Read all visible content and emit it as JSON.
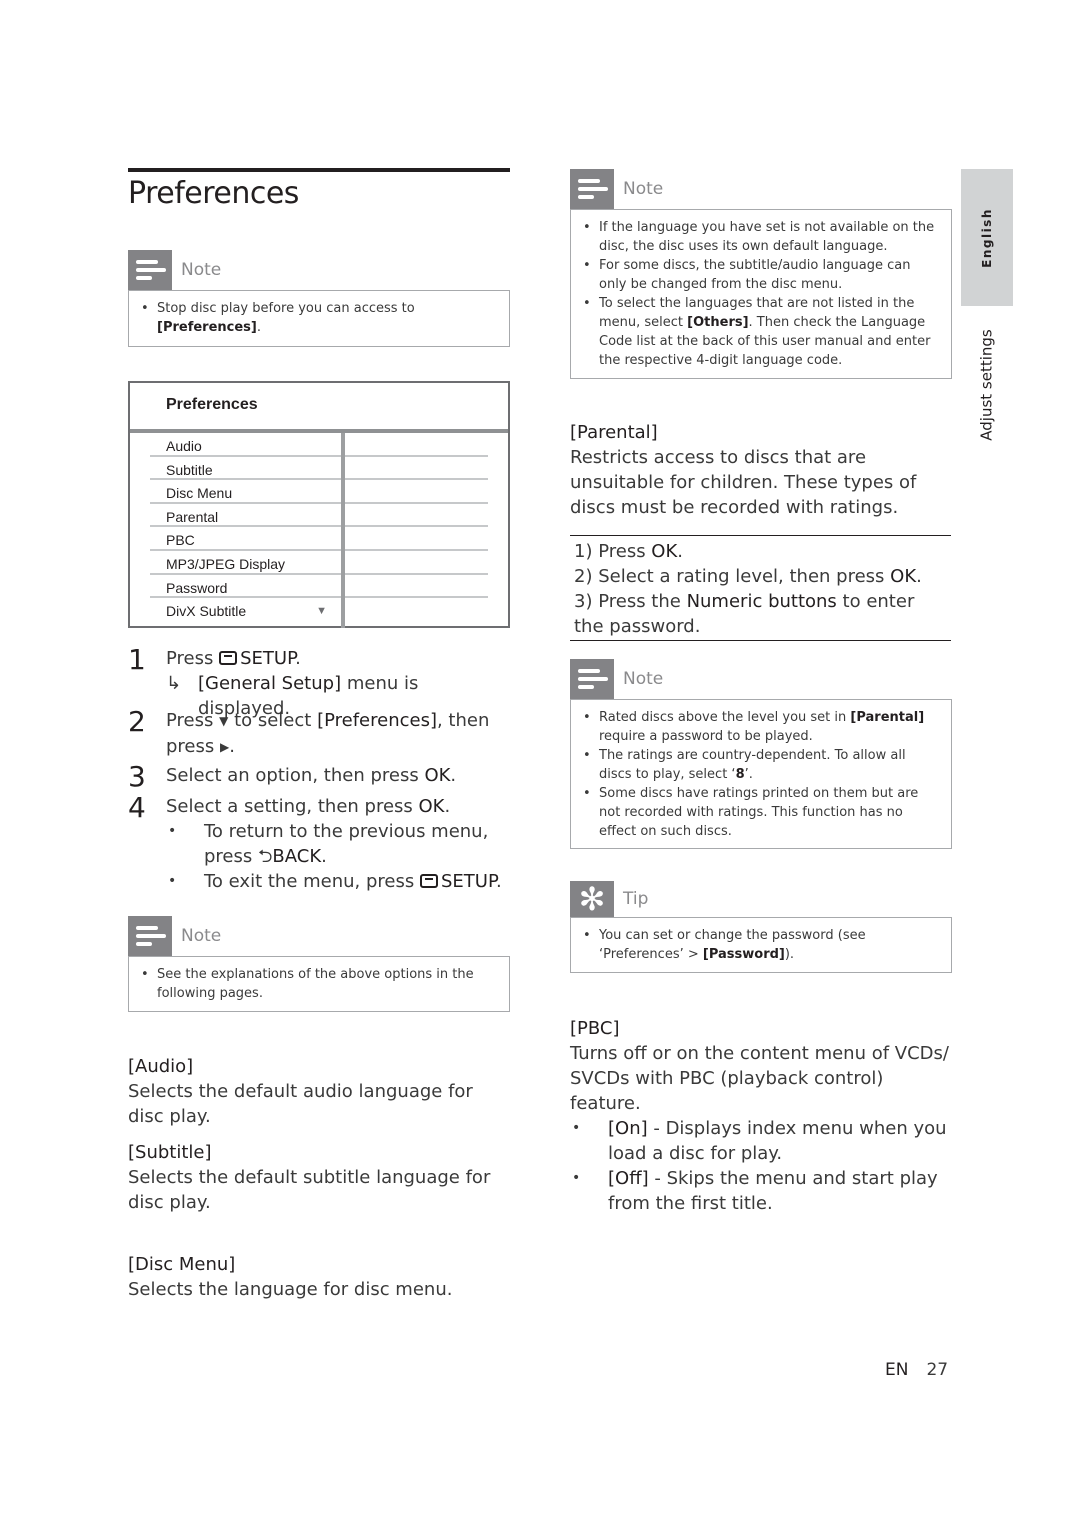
{
  "section": {
    "title": "Preferences"
  },
  "side_tab": {
    "language": "English",
    "section": "Adjust settings"
  },
  "note_stop": {
    "label": "Note",
    "items": [
      {
        "text": "Stop disc play before you can access to ",
        "bold": "[Preferences]",
        "after": "."
      }
    ]
  },
  "osd_menu": {
    "title": "Preferences",
    "items": [
      "Audio",
      "Subtitle",
      "Disc Menu",
      "Parental",
      "PBC",
      "MP3/JPEG Display",
      "Password",
      "DivX Subtitle"
    ],
    "scroll_indicator": "▼"
  },
  "steps": [
    {
      "num": "1",
      "pre": "Press ",
      "icon": "setup-icon",
      "key": "SETUP",
      "post": ".",
      "result_arrow": "↳",
      "result_bold": "[General Setup]",
      "result_text": " menu is displayed."
    },
    {
      "num": "2",
      "pre": "Press ",
      "icon": "down-triangle-icon",
      "mid": " to select ",
      "bold": "[Preferences]",
      "post": ", then press ",
      "icon2": "right-triangle-icon",
      "end": "."
    },
    {
      "num": "3",
      "text": "Select an option, then press ",
      "key": "OK",
      "post": "."
    },
    {
      "num": "4",
      "text": "Select a setting, then press ",
      "key": "OK",
      "post": ".",
      "bullets": [
        {
          "pre": "To return to the previous menu, press ",
          "icon": "back-icon",
          "key": "BACK",
          "post": "."
        },
        {
          "pre": "To exit the menu, press ",
          "icon": "setup-icon",
          "key": "SETUP",
          "post": "."
        }
      ]
    }
  ],
  "note_explain": {
    "label": "Note",
    "items": [
      {
        "text": "See the explanations of the above options in the following pages."
      }
    ]
  },
  "options_left": [
    {
      "heading": "[Audio]",
      "desc": "Selects the default audio language for disc play."
    },
    {
      "heading": "[Subtitle]",
      "desc": "Selects the default subtitle language for disc play."
    },
    {
      "heading": "[Disc Menu]",
      "desc": "Selects the language for disc menu."
    }
  ],
  "note_language": {
    "label": "Note",
    "items": [
      {
        "text": "If the language you have set is not available on the disc, the disc uses its own default language."
      },
      {
        "text": "For some discs, the subtitle/audio language can only be changed from the disc menu."
      },
      {
        "pre": "To select the languages that are not listed in the menu, select ",
        "bold": "[Others]",
        "post": ". Then check the Language Code list at the back of this user manual and enter the respective 4-digit language code."
      }
    ]
  },
  "parental": {
    "heading": "[Parental]",
    "desc": "Restricts access to discs that are unsuitable for children. These types of discs must be recorded with ratings.",
    "steps": [
      {
        "pre": "1) Press ",
        "bold": "OK",
        "post": "."
      },
      {
        "pre": "2) Select a rating level, then press ",
        "bold": "OK",
        "post": "."
      },
      {
        "pre": "3) Press the ",
        "bold": "Numeric buttons",
        "post": " to enter the password."
      }
    ]
  },
  "note_ratings": {
    "label": "Note",
    "items": [
      {
        "pre": "Rated discs above the level you set in ",
        "bold": "[Parental]",
        "post": " require a password to be played."
      },
      {
        "pre": "The ratings are country-dependent. To allow all discs to play, select ‘",
        "bold": "8",
        "post": "’."
      },
      {
        "text": "Some discs have ratings printed on them but are not recorded with ratings. This function has no effect on such discs."
      }
    ]
  },
  "tip_password": {
    "label": "Tip",
    "items": [
      {
        "pre": "You can set or change the password (see ‘Preferences’ > ",
        "bold": "[Password]",
        "post": ")."
      }
    ]
  },
  "pbc": {
    "heading": "[PBC]",
    "desc": "Turns off or on the content menu of VCDs/ SVCDs with PBC (playback control) feature.",
    "options": [
      {
        "bold": "[On]",
        "text": " - Displays index menu when you load a disc for play."
      },
      {
        "bold": "[Off]",
        "text": " - Skips the menu and start play from the first title."
      }
    ]
  },
  "footer": {
    "lang": "EN",
    "page": "27"
  }
}
